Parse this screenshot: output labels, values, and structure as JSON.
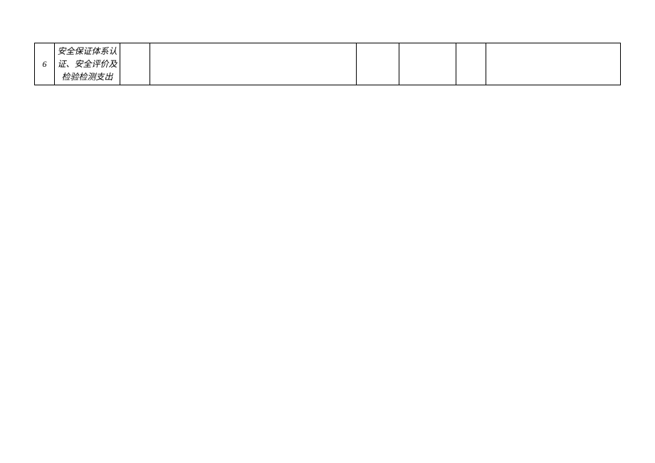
{
  "table": {
    "rows": [
      {
        "num": "6",
        "name": "安全保证体系认证、安全评价及检验检测支出",
        "c3": "",
        "c4": "",
        "c5": "",
        "c6": "",
        "c7": "",
        "c8": ""
      }
    ]
  }
}
